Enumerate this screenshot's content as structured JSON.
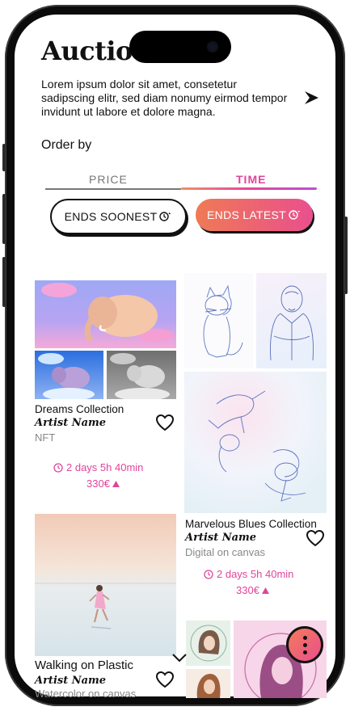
{
  "screen": {
    "title": "Auctio",
    "intro": "Lorem ipsum dolor sit amet, consetetur sadipscing elitr, sed diam nonumy eirmod tempor invidunt ut labore et dolore magna.",
    "order_by_label": "Order by"
  },
  "tabs": [
    {
      "label": "PRICE",
      "active": false
    },
    {
      "label": "TIME",
      "active": true
    }
  ],
  "sort_buttons": [
    {
      "label": "ENDS SOONEST",
      "icon": "clock-up-icon",
      "active": false
    },
    {
      "label": "ENDS LATEST",
      "icon": "clock-down-icon",
      "active": true
    }
  ],
  "items": [
    {
      "title": "Dreams Collection",
      "artist": "Artist Name",
      "type": "NFT",
      "time_left": "2 days 5h 40min",
      "price": "330€"
    },
    {
      "title": "Marvelous Blues Collection",
      "artist": "Artist Name",
      "type": "Digital on canvas",
      "time_left": "2 days 5h 40min",
      "price": "330€"
    },
    {
      "title": "Walking on Plastic",
      "artist": "Artist Name",
      "type": "Watercolor on canvas"
    }
  ],
  "colors": {
    "accent": "#e0459a",
    "gradient_start": "#ef7a55",
    "gradient_end": "#b94fd9",
    "text": "#111111",
    "muted": "#888888"
  }
}
